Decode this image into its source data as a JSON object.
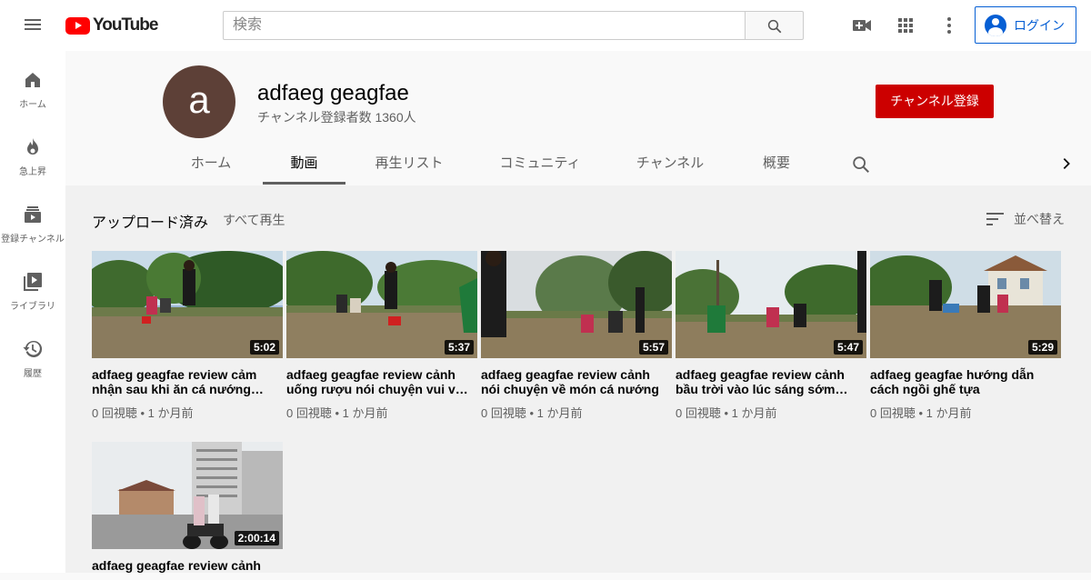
{
  "header": {
    "logo_text": "YouTube",
    "search_placeholder": "検索",
    "login_label": "ログイン"
  },
  "sidebar": {
    "items": [
      {
        "label": "ホーム",
        "icon": "home-icon"
      },
      {
        "label": "急上昇",
        "icon": "flame-icon"
      },
      {
        "label": "登録チャンネル",
        "icon": "subscriptions-icon"
      },
      {
        "label": "ライブラリ",
        "icon": "library-icon"
      },
      {
        "label": "履歴",
        "icon": "history-icon"
      }
    ]
  },
  "channel": {
    "avatar_letter": "a",
    "name": "adfaeg geagfae",
    "subscribers": "チャンネル登録者数 1360人",
    "subscribe_label": "チャンネル登録"
  },
  "tabs": [
    {
      "label": "ホーム",
      "active": false
    },
    {
      "label": "動画",
      "active": true
    },
    {
      "label": "再生リスト",
      "active": false
    },
    {
      "label": "コミュニティ",
      "active": false
    },
    {
      "label": "チャンネル",
      "active": false
    },
    {
      "label": "概要",
      "active": false
    }
  ],
  "shelf": {
    "title": "アップロード済み",
    "play_all": "すべて再生",
    "sort_label": "並べ替え"
  },
  "videos": [
    {
      "title": "adfaeg geagfae review cảm nhận sau khi ăn cá nướng…",
      "meta": "0 回視聴 • 1 か月前",
      "duration": "5:02"
    },
    {
      "title": "adfaeg geagfae review cảnh uống rượu nói chuyện vui v…",
      "meta": "0 回視聴 • 1 か月前",
      "duration": "5:37"
    },
    {
      "title": "adfaeg geagfae review cảnh nói chuyện về món cá nướng",
      "meta": "0 回視聴 • 1 か月前",
      "duration": "5:57"
    },
    {
      "title": "adfaeg geagfae review cảnh bầu trời vào lúc sáng sớm…",
      "meta": "0 回視聴 • 1 か月前",
      "duration": "5:47"
    },
    {
      "title": "adfaeg geagfae hướng dẫn cách ngồi ghế tựa",
      "meta": "0 回視聴 • 1 か月前",
      "duration": "5:29"
    },
    {
      "title": "adfaeg geagfae review cảnh",
      "meta": "",
      "duration": "2:00:14"
    }
  ],
  "colors": {
    "brand_red": "#ff0000",
    "subscribe_red": "#cc0000",
    "link_blue": "#065fd4",
    "avatar_brown": "#5d4037"
  }
}
